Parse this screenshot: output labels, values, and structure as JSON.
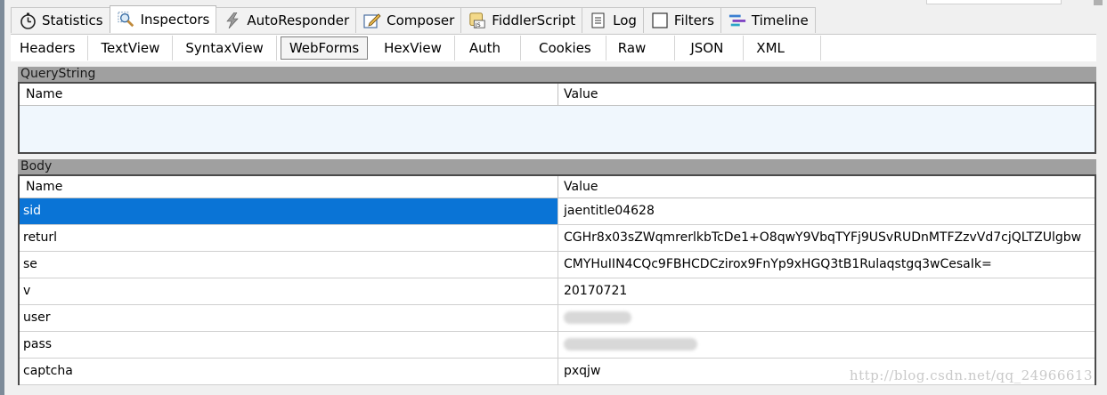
{
  "main_tabs": [
    {
      "label": "Statistics",
      "icon": "stopwatch-icon"
    },
    {
      "label": "Inspectors",
      "icon": "magnifier-icon",
      "active": true
    },
    {
      "label": "AutoResponder",
      "icon": "lightning-icon"
    },
    {
      "label": "Composer",
      "icon": "pencil-icon"
    },
    {
      "label": "FiddlerScript",
      "icon": "script-js-icon"
    },
    {
      "label": "Log",
      "icon": "log-icon"
    },
    {
      "label": "Filters",
      "icon": "checkbox-icon"
    },
    {
      "label": "Timeline",
      "icon": "timeline-icon"
    }
  ],
  "sub_tabs": [
    {
      "label": "Headers"
    },
    {
      "label": "TextView"
    },
    {
      "label": "SyntaxView"
    },
    {
      "label": "WebForms",
      "active": true
    },
    {
      "label": "HexView"
    },
    {
      "label": "Auth"
    },
    {
      "label": "Cookies"
    },
    {
      "label": "Raw"
    },
    {
      "label": "JSON"
    },
    {
      "label": "XML"
    }
  ],
  "querystring": {
    "title": "QueryString",
    "col_name": "Name",
    "col_value": "Value"
  },
  "body": {
    "title": "Body",
    "col_name": "Name",
    "col_value": "Value",
    "rows": [
      {
        "name": "sid",
        "value": "jaentitle04628",
        "selected": true
      },
      {
        "name": "returl",
        "value": "CGHr8x03sZWqmrerlkbTcDe1+O8qwY9VbqTYFj9USvRUDnMTFZzvVd7cjQLTZUlgbw"
      },
      {
        "name": "se",
        "value": "CMYHuIIN4CQc9FBHCDCzirox9FnYp9xHGQ3tB1Rulaqstgq3wCesaIk="
      },
      {
        "name": "v",
        "value": "20170721"
      },
      {
        "name": "user",
        "value": "",
        "blurred": true
      },
      {
        "name": "pass",
        "value": "",
        "blurred": true
      },
      {
        "name": "captcha",
        "value": "pxqjw"
      }
    ]
  },
  "watermark": "http://blog.csdn.net/qq_24966613",
  "colors": {
    "selection": "#0a74d6",
    "section_header": "#a0a0a0",
    "grid_border": "#4a4a4a"
  }
}
